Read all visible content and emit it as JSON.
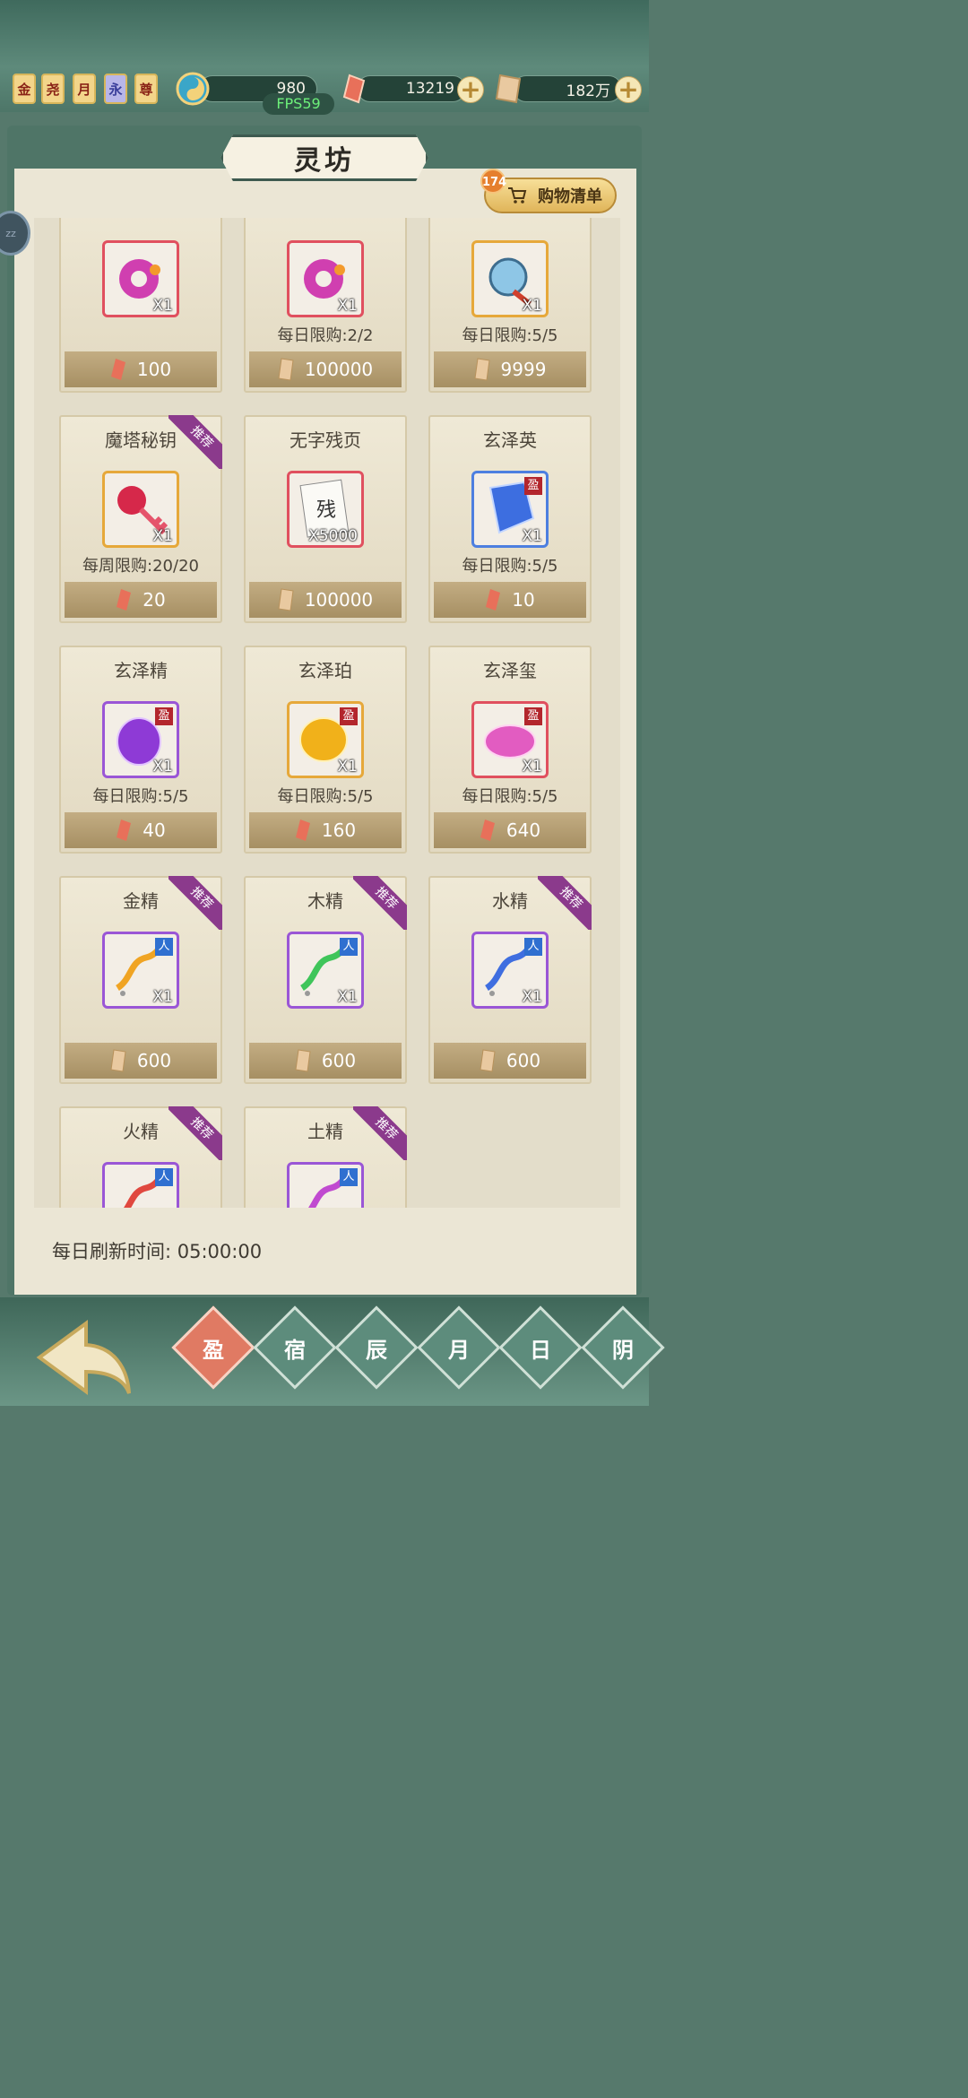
{
  "top": {
    "badges": [
      "金",
      "尧",
      "月",
      "永",
      "尊"
    ],
    "jade_value": "980",
    "crystal_value": "13219",
    "scroll_value": "182万",
    "fps": "FPS59"
  },
  "panel": {
    "title": "灵坊",
    "cart_label": "购物清单",
    "cart_count": "174",
    "side_label": "zz",
    "refresh_label": "每日刷新时间: 05:00:00"
  },
  "items": [
    {
      "name": "",
      "qty": "X1",
      "limit": "",
      "price": "100",
      "currency": "crystal",
      "frame": "red",
      "tag": "",
      "ribbon": "",
      "art": "ring"
    },
    {
      "name": "",
      "qty": "X1",
      "limit": "每日限购:2/2",
      "price": "100000",
      "currency": "scroll",
      "frame": "red",
      "tag": "",
      "ribbon": "",
      "art": "ring"
    },
    {
      "name": "",
      "qty": "X1",
      "limit": "每日限购:5/5",
      "price": "9999",
      "currency": "scroll",
      "frame": "gold",
      "tag": "",
      "ribbon": "",
      "art": "ball"
    },
    {
      "name": "魔塔秘钥",
      "qty": "X1",
      "limit": "每周限购:20/20",
      "price": "20",
      "currency": "crystal",
      "frame": "gold",
      "tag": "",
      "ribbon": "推荐",
      "art": "key"
    },
    {
      "name": "无字残页",
      "qty": "X5000",
      "limit": "",
      "price": "100000",
      "currency": "scroll",
      "frame": "red",
      "tag": "",
      "ribbon": "",
      "art": "page"
    },
    {
      "name": "玄泽英",
      "qty": "X1",
      "limit": "每日限购:5/5",
      "price": "10",
      "currency": "crystal",
      "frame": "blue",
      "tag": "盈",
      "ribbon": "",
      "art": "gem-blue"
    },
    {
      "name": "玄泽精",
      "qty": "X1",
      "limit": "每日限购:5/5",
      "price": "40",
      "currency": "crystal",
      "frame": "purple",
      "tag": "盈",
      "ribbon": "",
      "art": "gem-purple"
    },
    {
      "name": "玄泽珀",
      "qty": "X1",
      "limit": "每日限购:5/5",
      "price": "160",
      "currency": "crystal",
      "frame": "gold",
      "tag": "盈",
      "ribbon": "",
      "art": "gem-gold"
    },
    {
      "name": "玄泽玺",
      "qty": "X1",
      "limit": "每日限购:5/5",
      "price": "640",
      "currency": "crystal",
      "frame": "red",
      "tag": "盈",
      "ribbon": "",
      "art": "gem-pink"
    },
    {
      "name": "金精",
      "qty": "X1",
      "limit": "",
      "price": "600",
      "currency": "scroll",
      "frame": "purple",
      "tag": "人",
      "ribbon": "推荐",
      "art": "wisp-gold"
    },
    {
      "name": "木精",
      "qty": "X1",
      "limit": "",
      "price": "600",
      "currency": "scroll",
      "frame": "purple",
      "tag": "人",
      "ribbon": "推荐",
      "art": "wisp-green"
    },
    {
      "name": "水精",
      "qty": "X1",
      "limit": "",
      "price": "600",
      "currency": "scroll",
      "frame": "purple",
      "tag": "人",
      "ribbon": "推荐",
      "art": "wisp-blue"
    },
    {
      "name": "火精",
      "qty": "",
      "limit": "",
      "price": "",
      "currency": "scroll",
      "frame": "purple",
      "tag": "人",
      "ribbon": "推荐",
      "art": "wisp-red"
    },
    {
      "name": "土精",
      "qty": "",
      "limit": "",
      "price": "",
      "currency": "scroll",
      "frame": "purple",
      "tag": "人",
      "ribbon": "推荐",
      "art": "wisp-pink"
    }
  ],
  "nav": {
    "tabs": [
      "盈",
      "宿",
      "辰",
      "月",
      "日",
      "阴"
    ],
    "active": 0
  },
  "colors": {
    "crystal": "#e8705a",
    "scroll": "#e9c9a0",
    "ribbon": "#8b3a8c",
    "frame_red": "#e0505f",
    "frame_gold": "#e6a83a",
    "frame_blue": "#4d7fe0",
    "frame_purple": "#9a56d6"
  }
}
